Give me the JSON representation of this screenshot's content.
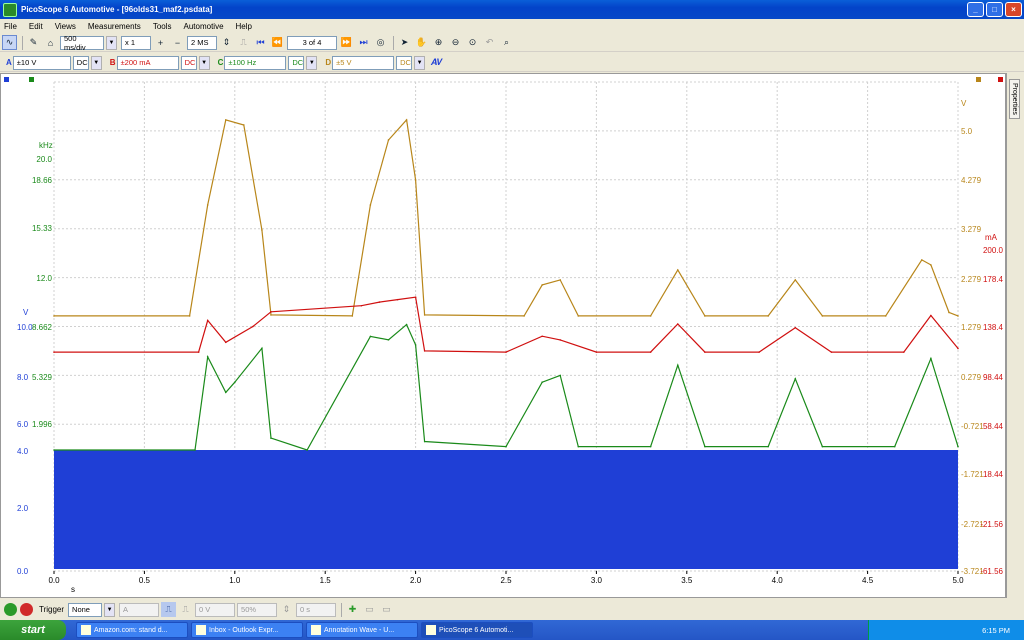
{
  "window": {
    "title": "PicoScope 6 Automotive - [96olds31_maf2.psdata]",
    "minimize": "_",
    "maximize": "□",
    "close": "×"
  },
  "menu": [
    "File",
    "Edit",
    "Views",
    "Measurements",
    "Tools",
    "Automotive",
    "Help"
  ],
  "toolbar": {
    "timebase": "500 ms/div",
    "zoom": "x 1",
    "samples": "2 MS",
    "buffer": "3 of 4"
  },
  "channels": [
    {
      "letter": "A",
      "range": "±10 V",
      "coupling": "DC",
      "color": "#1f3fd6"
    },
    {
      "letter": "B",
      "range": "±200 mA",
      "coupling": "DC",
      "color": "#d01010"
    },
    {
      "letter": "C",
      "range": "±100 Hz",
      "coupling": "DC",
      "color": "#1a8a1a"
    },
    {
      "letter": "D",
      "range": "±5 V",
      "coupling": "DC",
      "color": "#b8861a"
    }
  ],
  "trigger": {
    "label": "Trigger",
    "mode": "None",
    "source": "A",
    "level": "0 V",
    "pretrigger": "50%",
    "delay": "0 s"
  },
  "side_tab": "Properties",
  "taskbar": {
    "start": "start",
    "tasks": [
      "Amazon.com: stand d...",
      "Inbox - Outlook Expr...",
      "Annotation Wave - U...",
      "PicoScope 6 Automoti..."
    ],
    "clock": "6:15 PM"
  },
  "chart_data": {
    "type": "line",
    "x_unit": "s",
    "x": [
      0.0,
      0.5,
      1.0,
      1.5,
      2.0,
      2.5,
      3.0,
      3.5,
      4.0,
      4.5,
      5.0
    ],
    "x_tick_labels": [
      "0.0",
      "0.5",
      "1.0",
      "1.5",
      "2.0",
      "2.5",
      "3.0",
      "3.5",
      "4.0",
      "4.5",
      "5.0"
    ],
    "xlim": [
      0,
      5
    ],
    "axes": {
      "A": {
        "unit": "V",
        "ticks": [
          "0.0",
          "2.0",
          "4.0",
          "6.0",
          "8.0",
          "10.0"
        ],
        "ylim": [
          0,
          10
        ]
      },
      "B": {
        "unit": "mA",
        "ticks": [
          "-61.56",
          "-21.56",
          "18.44",
          "58.44",
          "98.44",
          "138.4",
          "178.4",
          "200.0"
        ]
      },
      "C": {
        "unit": "kHz",
        "ticks": [
          "1.996",
          "5.329",
          "8.662",
          "12.0",
          "15.33",
          "18.66",
          "20.0"
        ]
      },
      "D": {
        "unit": "V",
        "ticks": [
          "-3.721",
          "-2.721",
          "-1.721",
          "-0.721",
          "0.279",
          "1.279",
          "2.279",
          "3.279",
          "4.279",
          "5.0"
        ]
      }
    },
    "series": [
      {
        "name": "A",
        "color": "#1f3fd6",
        "description_type": "fill",
        "range": [
          0,
          5
        ]
      },
      {
        "name": "B",
        "color": "#d01010",
        "x": [
          0.0,
          0.8,
          0.85,
          0.95,
          1.1,
          1.2,
          1.7,
          1.8,
          1.9,
          2.0,
          2.05,
          2.5,
          2.7,
          2.8,
          3.0,
          3.3,
          3.45,
          3.6,
          3.9,
          4.1,
          4.3,
          4.7,
          4.85,
          5.0
        ],
        "y": [
          117,
          117,
          143,
          125,
          138,
          150,
          155,
          158,
          160,
          162,
          118,
          117,
          130,
          127,
          117,
          117,
          140,
          117,
          117,
          137,
          117,
          117,
          147,
          120
        ]
      },
      {
        "name": "C",
        "color": "#1a8a1a",
        "x": [
          0.0,
          0.78,
          0.85,
          0.95,
          1.0,
          1.15,
          1.2,
          1.4,
          1.75,
          1.85,
          1.95,
          2.0,
          2.05,
          2.5,
          2.7,
          2.8,
          2.9,
          3.3,
          3.45,
          3.6,
          3.95,
          4.1,
          4.25,
          4.65,
          4.85,
          5.0
        ],
        "y": [
          1.8,
          1.8,
          7.3,
          5.2,
          5.8,
          7.8,
          2.5,
          1.8,
          8.5,
          8.3,
          9.2,
          8.0,
          2.3,
          2.0,
          5.8,
          6.2,
          2.0,
          2.0,
          6.8,
          2.0,
          2.0,
          6.0,
          2.0,
          2.0,
          7.2,
          2.0
        ]
      },
      {
        "name": "D",
        "color": "#b8861a",
        "x": [
          0.0,
          0.75,
          0.85,
          0.95,
          1.05,
          1.15,
          1.2,
          1.65,
          1.75,
          1.85,
          1.95,
          2.0,
          2.05,
          2.6,
          2.7,
          2.8,
          2.9,
          3.3,
          3.45,
          3.6,
          3.95,
          4.1,
          4.25,
          4.6,
          4.8,
          4.85,
          4.95,
          5.0
        ],
        "y": [
          0.28,
          0.28,
          2.5,
          4.2,
          4.1,
          2.0,
          0.3,
          0.28,
          2.5,
          3.8,
          4.2,
          3.0,
          0.3,
          0.28,
          0.9,
          1.0,
          0.28,
          0.28,
          1.2,
          0.28,
          0.28,
          1.0,
          0.28,
          0.28,
          1.4,
          1.3,
          0.35,
          0.28
        ]
      }
    ]
  }
}
